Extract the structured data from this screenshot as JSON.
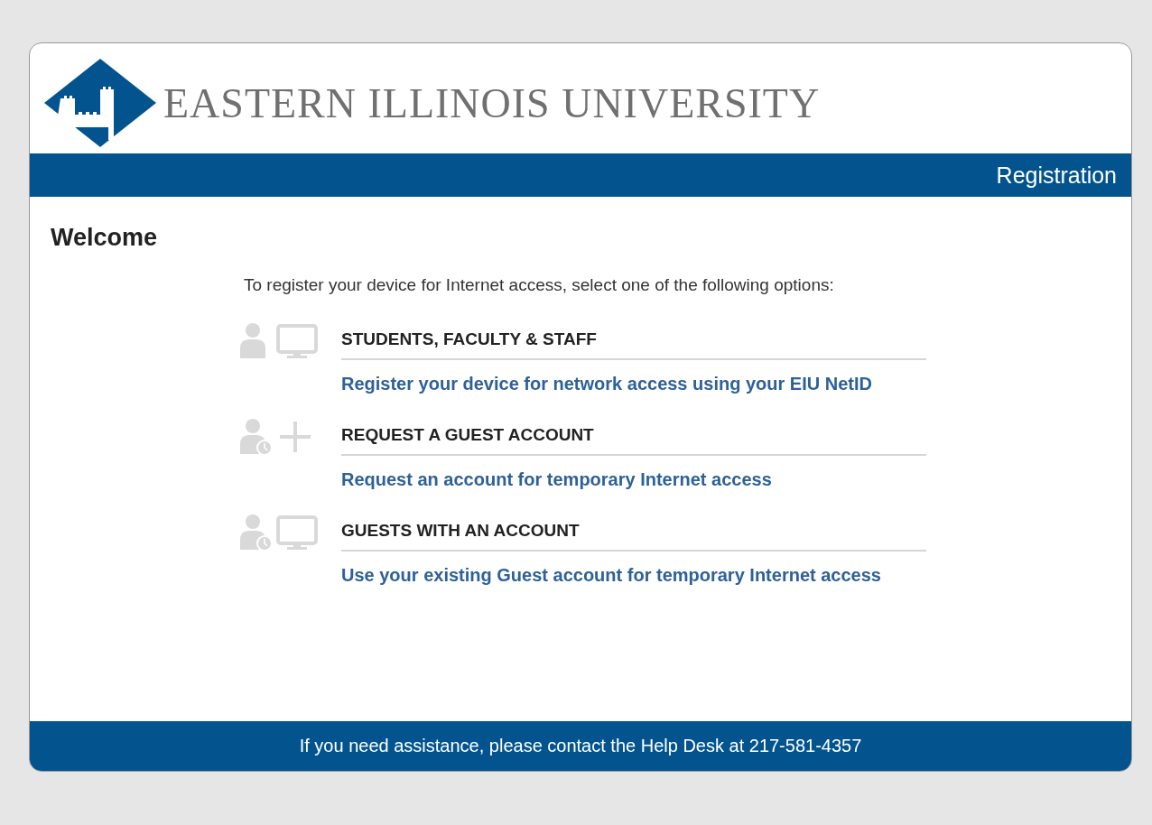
{
  "logo": {
    "name": "EASTERN ILLINOIS UNIVERSITY"
  },
  "header_bar": {
    "title": "Registration"
  },
  "heading": "Welcome",
  "intro": "To register your device for Internet access, select one of the following options:",
  "options": [
    {
      "kind": "user-monitor",
      "title": "STUDENTS, FACULTY & STAFF",
      "link": "Register your device for network access using your EIU NetID"
    },
    {
      "kind": "user-clock-plus",
      "title": "REQUEST A GUEST ACCOUNT",
      "link": "Request an account for temporary Internet access"
    },
    {
      "kind": "user-clock-monitor",
      "title": "GUESTS WITH AN ACCOUNT",
      "link": "Use your existing Guest account for temporary Internet access"
    }
  ],
  "footer": "If you need assistance, please contact the Help Desk at 217-581-4357"
}
